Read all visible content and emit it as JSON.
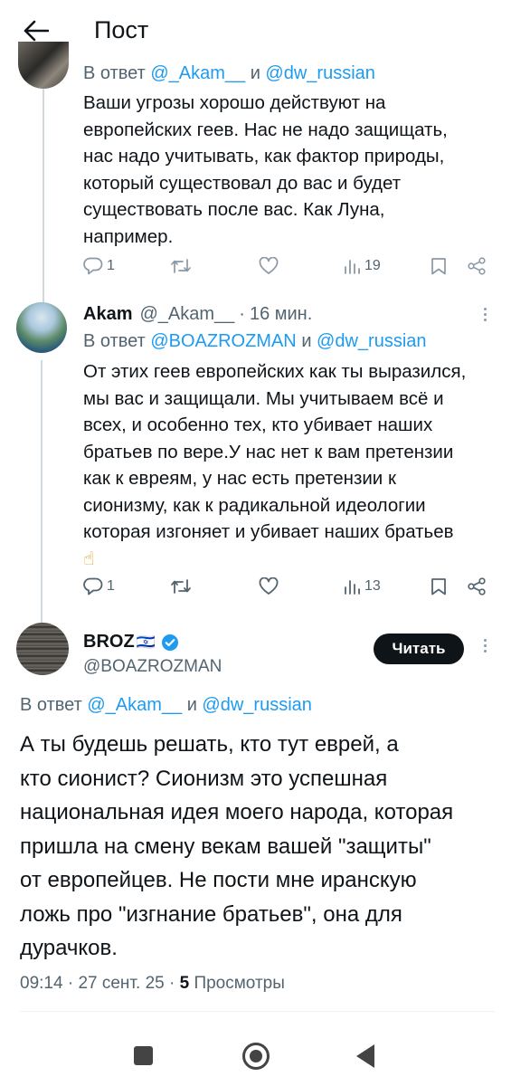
{
  "header": {
    "title": "Пост"
  },
  "tweet1": {
    "reply_prefix": "В ответ",
    "mention_a": "@_Akam__",
    "and": "и",
    "mention_b": "@dw_russian",
    "lines": [
      "Ваши угрозы хорошо действуют на",
      "европейских геев. Нас не надо защищать,",
      "нас надо учитывать, как фактор природы,",
      "который существовал до вас и будет",
      "существовать после вас. Как Луна,",
      "например."
    ],
    "reply_count": "1",
    "retweet_count": "",
    "like_count": "",
    "view_count": "19"
  },
  "tweet2": {
    "name": "Akam",
    "handle": "@_Akam__",
    "time": "16 мин.",
    "reply_prefix": "В ответ",
    "mention_a": "@BOAZROZMAN",
    "and": "и",
    "mention_b": "@dw_russian",
    "lines": [
      "От этих геев европейских как ты выразился,",
      "мы вас и защищали. Мы учитываем всё и",
      "всех, и особенно тех, кто убивает наших",
      "братьев по вере.У нас нет к вам претензии",
      "как к евреям, у нас есть претензии к",
      "сионизму, как к радикальной идеологии",
      "которая изгоняет и убивает наших братьев",
      "☝"
    ],
    "reply_count": "1",
    "view_count": "13"
  },
  "main_tweet": {
    "name": "BROZ",
    "flag": "🇮🇱",
    "handle": "@BOAZROZMAN",
    "follow_label": "Читать",
    "reply_prefix": "В ответ",
    "mention_a": "@_Akam__",
    "and": "и",
    "mention_b": "@dw_russian",
    "lines": [
      "А ты будешь решать, кто тут еврей, а",
      "кто сионист? Сионизм это успешная",
      "национальная идея моего народа, которая",
      "пришла на смену векам вашей \"защиты\"",
      "от европейцев. Не пости мне иранскую",
      "ложь про \"изгнание братьев\", она для",
      "дурачков."
    ],
    "time": "09:14",
    "date": "27 сент. 25",
    "views_count": "5",
    "views_label": "Просмотры"
  },
  "colors": {
    "accent": "#1d9bf0",
    "text": "#0f1419",
    "muted": "#536471",
    "verified": "#1d9bf0"
  }
}
